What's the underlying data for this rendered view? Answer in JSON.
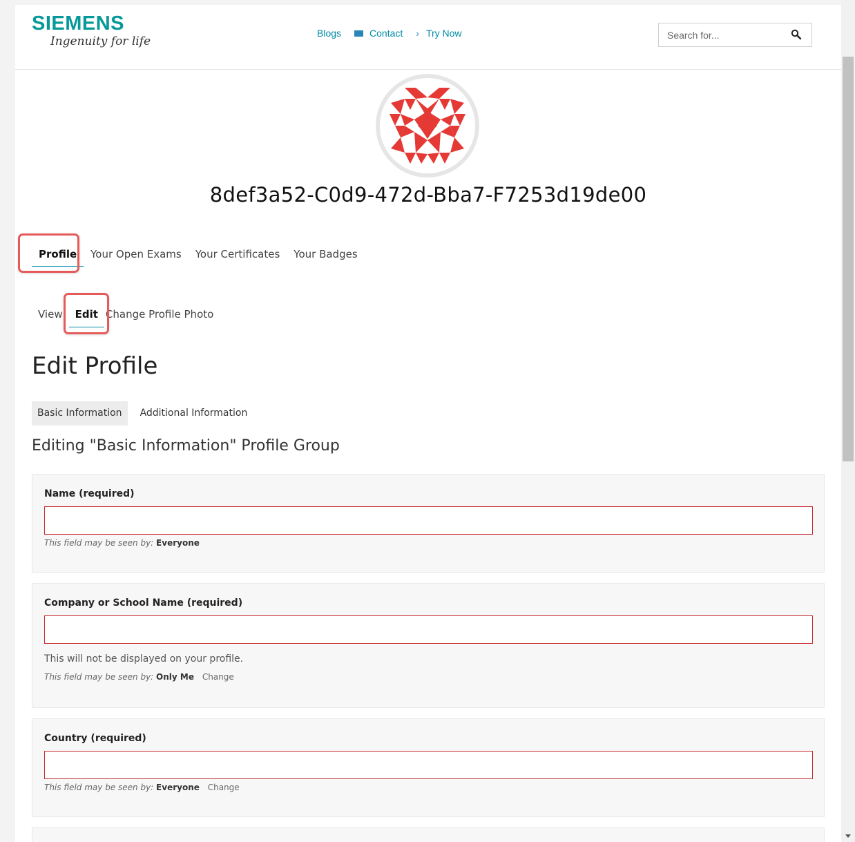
{
  "header": {
    "logo_word": "SIEMENS",
    "logo_tagline": "Ingenuity for life",
    "nav": {
      "blogs": "Blogs",
      "contact": "Contact",
      "try_now": "Try Now"
    },
    "search": {
      "placeholder": "Search for..."
    }
  },
  "profile": {
    "username": "8def3a52-C0d9-472d-Bba7-F7253d19de00",
    "avatar_color": "#e53935"
  },
  "tabs": [
    "Profile",
    "Your Open Exams",
    "Your Certificates",
    "Your Badges"
  ],
  "subtabs": [
    "View",
    "Edit",
    "Change Profile Photo"
  ],
  "page_title": "Edit Profile",
  "groups": [
    "Basic Information",
    "Additional Information"
  ],
  "editing_title": "Editing \"Basic Information\" Profile Group",
  "fields": [
    {
      "label": "Name (required)",
      "value": "",
      "vis_prefix": "This field may be seen by:",
      "vis_level": "Everyone"
    },
    {
      "label": "Company or School Name (required)",
      "value": "",
      "description": "This will not be displayed on your profile.",
      "vis_prefix": "This field may be seen by:",
      "vis_level": "Only Me",
      "change": "Change"
    },
    {
      "label": "Country (required)",
      "value": "",
      "vis_prefix": "This field may be seen by:",
      "vis_level": "Everyone",
      "change": "Change"
    }
  ],
  "colors": {
    "brand": "#079999",
    "link": "#008aa6",
    "error_border": "#c8282e",
    "highlight": "#e65a5a"
  }
}
